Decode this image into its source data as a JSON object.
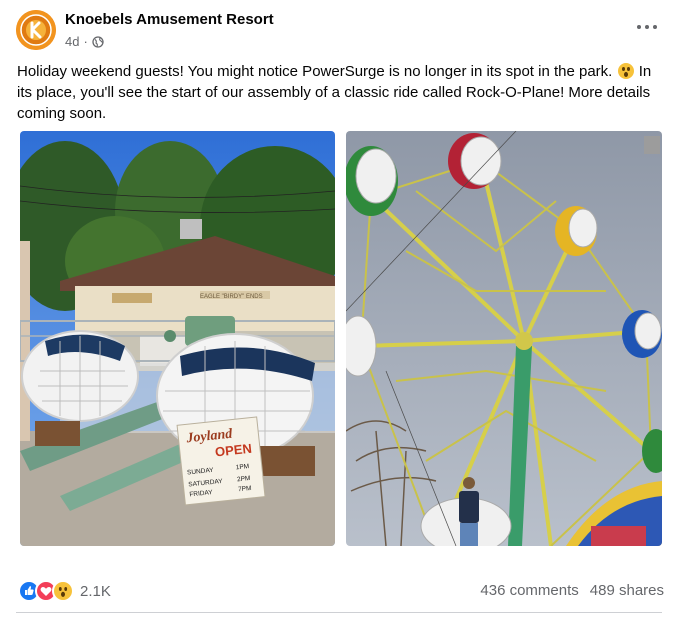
{
  "post": {
    "author": "Knoebels Amusement Resort",
    "age": "4d",
    "separator": "·",
    "text_part1": "Holiday weekend guests! You might notice PowerSurge is no longer in its spot in the park.",
    "text_part2": "In its place, you'll see the start of our assembly of a classic ride called Rock-O-Plane! More details coming soon.",
    "inline_emoji": "astonished-face-emoji",
    "more_icon": "more-options-icon",
    "privacy_icon": "globe-icon"
  },
  "photo_left": {
    "sign_title": "Joyland",
    "sign_open": "OPEN",
    "sign_rows": [
      {
        "day": "SUNDAY",
        "time": "1PM"
      },
      {
        "day": "SATURDAY",
        "time": "2PM"
      },
      {
        "day": "FRIDAY",
        "time": "7PM"
      }
    ],
    "building_sign": "EAGLE \"BIRDY\" ENDS"
  },
  "engagement": {
    "reaction_icons": [
      "like-icon",
      "love-icon",
      "wow-icon"
    ],
    "reaction_count": "2.1K",
    "comments": "436 comments",
    "shares": "489 shares"
  },
  "colors": {
    "text": "#050505",
    "secondary": "#65676b",
    "like": "#1877f2",
    "love": "#f33e58",
    "wow": "#f7c23a"
  }
}
